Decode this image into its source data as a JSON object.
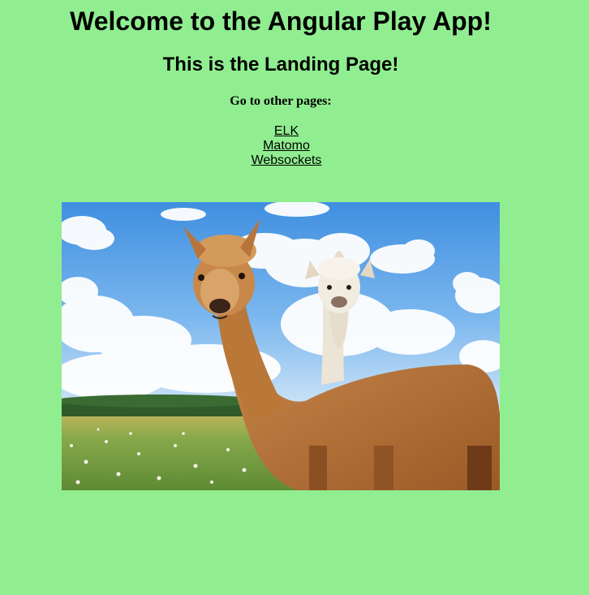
{
  "page": {
    "title": "Welcome to the Angular Play App!",
    "subtitle": "This is the Landing Page!",
    "nav_heading": "Go to other pages:",
    "links": [
      {
        "label": "ELK"
      },
      {
        "label": "Matomo"
      },
      {
        "label": "Websockets"
      }
    ]
  },
  "colors": {
    "background": "#90ee90",
    "text": "#000000"
  }
}
